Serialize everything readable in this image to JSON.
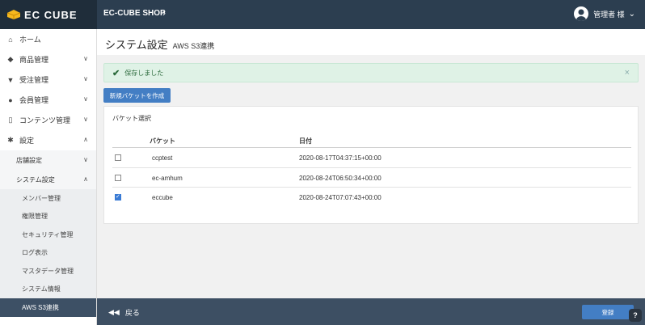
{
  "brand": {
    "logo_text": "EC CUBE",
    "shop_name": "EC-CUBE SHOP"
  },
  "user": {
    "name": "管理者 様"
  },
  "sidebar": {
    "items": [
      {
        "label": "ホーム",
        "icon": "home-icon"
      },
      {
        "label": "商品管理",
        "icon": "cube-icon"
      },
      {
        "label": "受注管理",
        "icon": "cart-icon"
      },
      {
        "label": "会員管理",
        "icon": "users-icon"
      },
      {
        "label": "コンテンツ管理",
        "icon": "file-icon"
      },
      {
        "label": "設定",
        "icon": "gear-icon"
      }
    ],
    "sub_items": [
      {
        "label": "店舗設定"
      },
      {
        "label": "システム設定"
      }
    ],
    "system_items": [
      {
        "label": "メンバー管理"
      },
      {
        "label": "権限管理"
      },
      {
        "label": "セキュリティ管理"
      },
      {
        "label": "ログ表示"
      },
      {
        "label": "マスタデータ管理"
      },
      {
        "label": "システム情報"
      },
      {
        "label": "AWS S3連携"
      }
    ]
  },
  "page": {
    "title": "システム設定",
    "subtitle": "AWS S3連携"
  },
  "alert": {
    "message": "保存しました",
    "close": "×"
  },
  "actions": {
    "create_bucket": "新規バケットを作成"
  },
  "bucket_card": {
    "title": "バケット選択",
    "columns": {
      "bucket": "バケット",
      "date": "日付"
    },
    "rows": [
      {
        "name": "ccptest",
        "date": "2020-08-17T04:37:15+00:00",
        "checked": false
      },
      {
        "name": "ec-amhum",
        "date": "2020-08-24T06:50:34+00:00",
        "checked": false
      },
      {
        "name": "eccube",
        "date": "2020-08-24T07:07:43+00:00",
        "checked": true
      }
    ]
  },
  "footer": {
    "back_label": "戻る",
    "save_label": "登録"
  },
  "colors": {
    "topbar": "#2c3e50",
    "primary": "#437ec4",
    "success_bg": "#dff2e6"
  }
}
